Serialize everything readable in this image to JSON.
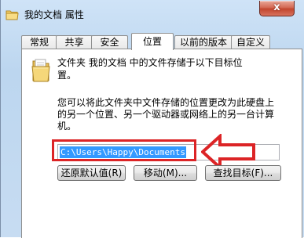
{
  "window": {
    "title": "我的文档 属性",
    "close_label": "x"
  },
  "tabs": [
    {
      "label": "常规",
      "active": false
    },
    {
      "label": "共享",
      "active": false
    },
    {
      "label": "安全",
      "active": false
    },
    {
      "label": "位置",
      "active": true
    },
    {
      "label": "以前的版本",
      "active": false
    },
    {
      "label": "自定义",
      "active": false
    }
  ],
  "location": {
    "description_line1": "文件夹 我的文档 中的文件存储于以下目标位",
    "description_line2": "置。",
    "info_line1": "您可以将此文件夹中文件存储的位置更改为此硬盘上",
    "info_line2": "的另一个位置、另一个驱动器或网络上的另一台计算",
    "info_line3": "机。",
    "path_value": "C:\\Users\\Happy\\Documents"
  },
  "buttons": {
    "restore_default": "还原默认值(R)",
    "move": "移动(M)...",
    "find_target": "查找目标(F)..."
  },
  "annotation": {
    "highlight_color": "#dc2426"
  },
  "icons": {
    "title": "folder-icon",
    "folder": "folder-icon",
    "annotation": "arrow-left-icon"
  }
}
